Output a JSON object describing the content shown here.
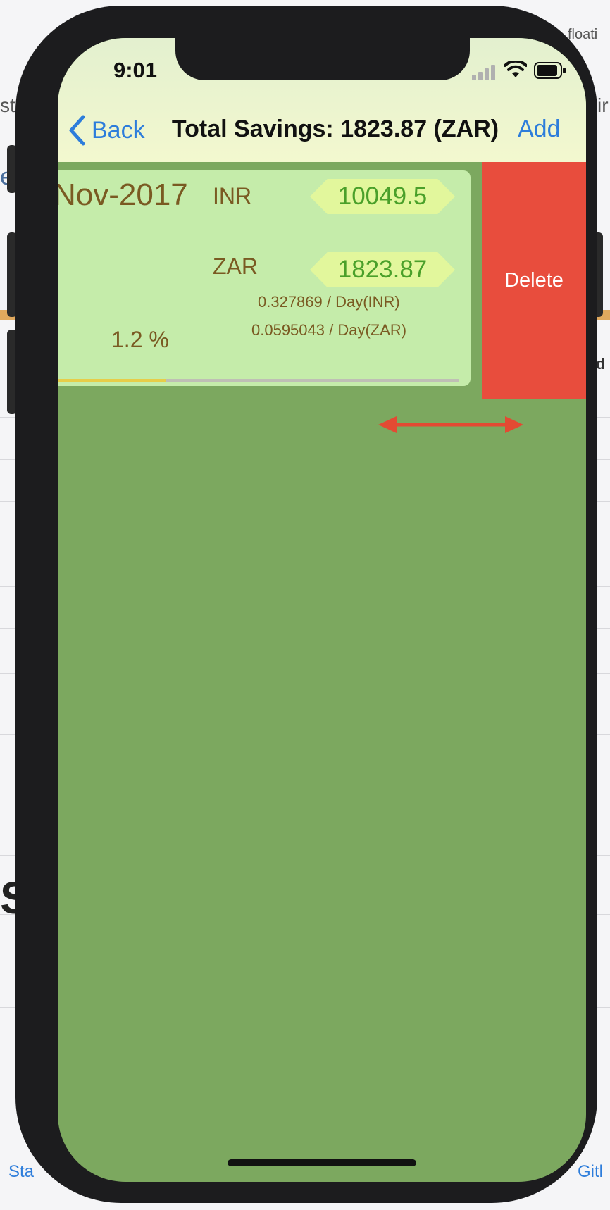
{
  "background": {
    "text_top_right": "floati",
    "text_left_1": "st",
    "text_right_1": "ir",
    "text_left_2": "e",
    "text_right_2": "d",
    "text_left_big": "Sa",
    "footer_left": "Sta",
    "footer_right": "Gitl"
  },
  "status_bar": {
    "time": "9:01",
    "signal_icon": "cellular-signal-icon",
    "wifi_icon": "wifi-icon",
    "battery_icon": "battery-icon"
  },
  "nav": {
    "back_label": "Back",
    "back_icon": "chevron-left-icon",
    "title": "Total Savings: 1823.87 (ZAR)",
    "add_label": "Add"
  },
  "row": {
    "date": "Nov-2017",
    "currency_1": "INR",
    "amount_1": "10049.5",
    "currency_2": "ZAR",
    "amount_2": "1823.87",
    "rate_1": "0.327869 / Day(INR)",
    "rate_2": "0.0595043 / Day(ZAR)",
    "percent": "1.2 %",
    "progress_fraction": 0.27,
    "delete_label": "Delete"
  },
  "colors": {
    "accent": "#2d7ddb",
    "delete": "#e84d3d",
    "background": "#7ca85f",
    "card": "#c5ecaa",
    "pill": "#e2f79c",
    "progress": "#e7cd49",
    "arrow": "#e34a33"
  },
  "annotation": {
    "icon": "double-arrow-icon"
  }
}
